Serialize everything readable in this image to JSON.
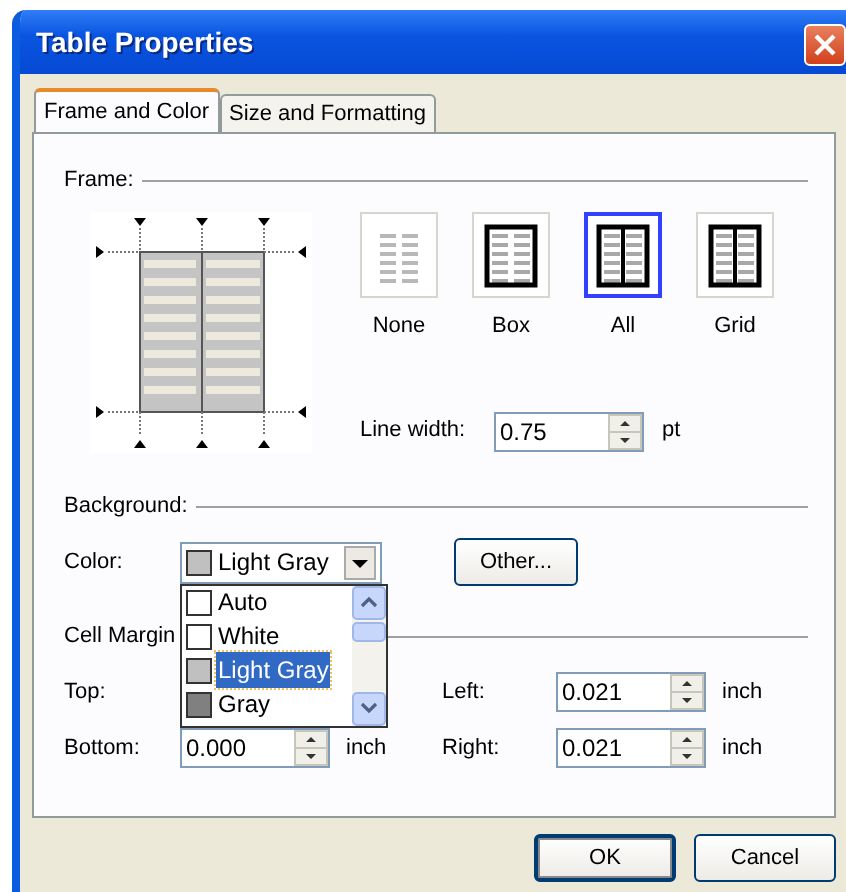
{
  "window": {
    "title": "Table Properties"
  },
  "tabs": [
    {
      "label": "Frame and Color",
      "selected": true
    },
    {
      "label": "Size and Formatting",
      "selected": false
    }
  ],
  "frame": {
    "heading": "Frame:",
    "options": [
      {
        "kind": "none",
        "label": "None",
        "selected": false
      },
      {
        "kind": "box",
        "label": "Box",
        "selected": false
      },
      {
        "kind": "all",
        "label": "All",
        "selected": true
      },
      {
        "kind": "grid",
        "label": "Grid",
        "selected": false
      }
    ],
    "line_width": {
      "label": "Line width:",
      "value": "0.75",
      "unit": "pt"
    }
  },
  "background": {
    "heading": "Background:",
    "color_label": "Color:",
    "value": "Light Gray",
    "color": "#c0c0c0",
    "other_button": "Other...",
    "dropdown": {
      "expanded": true,
      "items": [
        {
          "label": "Auto",
          "color": "#ffffff",
          "selected": false
        },
        {
          "label": "White",
          "color": "#ffffff",
          "selected": false
        },
        {
          "label": "Light Gray",
          "color": "#c0c0c0",
          "selected": true
        },
        {
          "label": "Gray",
          "color": "#808080",
          "selected": false
        }
      ]
    }
  },
  "cell_margins": {
    "heading": "Cell Margin",
    "fields": [
      {
        "label": "Top:"
      },
      {
        "label": "Left:",
        "value": "0.021",
        "unit": "inch"
      },
      {
        "label": "Bottom:",
        "value": "0.000",
        "unit": "inch"
      },
      {
        "label": "Right:",
        "value": "0.021",
        "unit": "inch"
      }
    ]
  },
  "buttons": [
    {
      "label": "OK",
      "default": true
    },
    {
      "label": "Cancel",
      "default": false
    }
  ]
}
